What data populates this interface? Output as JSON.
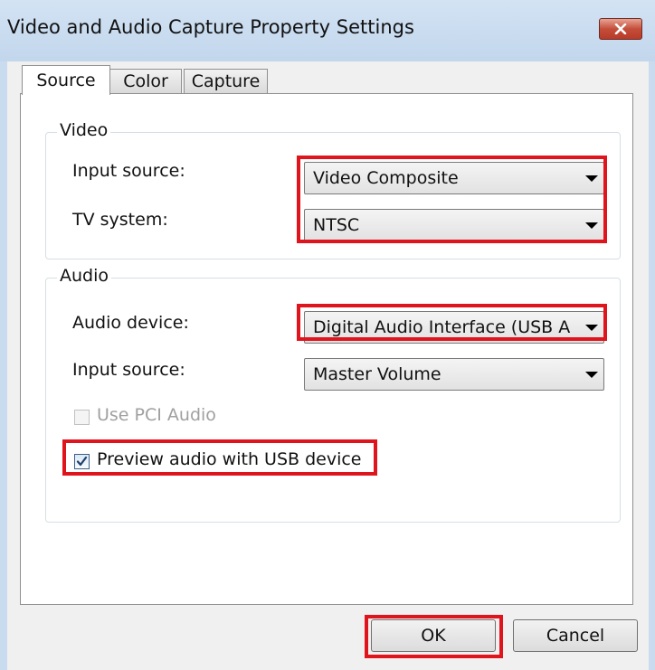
{
  "window": {
    "title": "Video and Audio Capture Property Settings"
  },
  "tabs": [
    {
      "label": "Source",
      "active": true
    },
    {
      "label": "Color",
      "active": false
    },
    {
      "label": "Capture",
      "active": false
    }
  ],
  "video": {
    "group_label": "Video",
    "input_source_label": "Input source:",
    "input_source_value": "Video Composite",
    "tv_system_label": "TV system:",
    "tv_system_value": "NTSC"
  },
  "audio": {
    "group_label": "Audio",
    "device_label": "Audio device:",
    "device_value": "Digital Audio Interface (USB A",
    "input_source_label": "Input source:",
    "input_source_value": "Master Volume",
    "use_pci_label": "Use PCI Audio",
    "use_pci_checked": false,
    "use_pci_enabled": false,
    "preview_label": "Preview audio with USB device",
    "preview_checked": true
  },
  "buttons": {
    "ok": "OK",
    "cancel": "Cancel"
  },
  "colors": {
    "highlight": "#e0141c",
    "close_button": "#c44e3a",
    "titlebar": "#c9dbee"
  },
  "icons": {
    "close": "close-icon",
    "dropdown": "chevron-down-icon",
    "check": "checkmark-icon"
  }
}
